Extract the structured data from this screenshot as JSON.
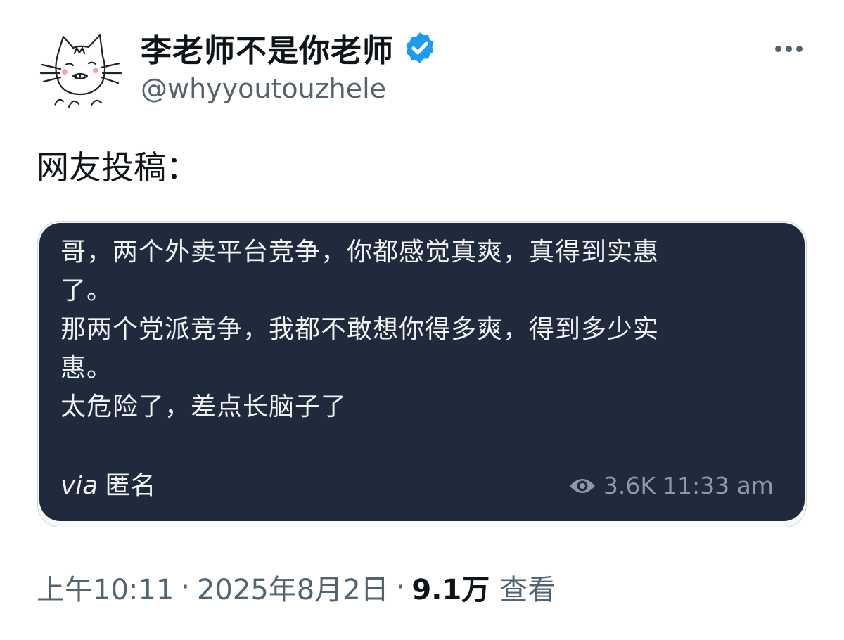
{
  "author": {
    "display_name": "李老师不是你老师",
    "handle": "@whyyoutouzhele",
    "avatar_icon": "cat-doodle-avatar-icon",
    "verified_icon": "verified-badge-icon"
  },
  "tweet": {
    "text": "网友投稿：",
    "more_icon": "more-options-icon"
  },
  "card": {
    "lines": [
      "哥，两个外卖平台竞争，你都感觉真爽，真得到实惠",
      "了。",
      "那两个党派竞争，我都不敢想你得多爽，得到多少实",
      "惠。",
      "太危险了，差点长脑子了"
    ],
    "via_label": "via",
    "via_source": "匿名",
    "views_icon": "eye-icon",
    "views": "3.6K",
    "time": "11:33 am"
  },
  "meta": {
    "time": "上午10:11",
    "separator": "·",
    "date": "2025年8月2日",
    "views_count": "9.1万",
    "views_label": "查看"
  },
  "colors": {
    "card_background": "#1f2b3c",
    "verified_blue": "#1d9bf0",
    "secondary_text": "#536471"
  }
}
